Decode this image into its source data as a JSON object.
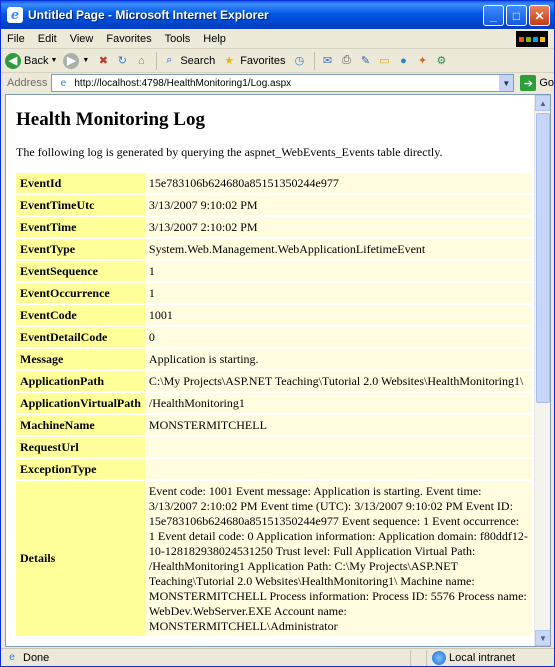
{
  "window": {
    "title": "Untitled Page - Microsoft Internet Explorer",
    "controls": {
      "minimize": "_",
      "maximize": "□",
      "close": "✕"
    }
  },
  "menu": [
    "File",
    "Edit",
    "View",
    "Favorites",
    "Tools",
    "Help"
  ],
  "toolbar": {
    "back_label": "Back",
    "search_label": "Search",
    "favorites_label": "Favorites"
  },
  "address": {
    "label": "Address",
    "url": "http://localhost:4798/HealthMonitoring1/Log.aspx",
    "go_label": "Go"
  },
  "page": {
    "heading": "Health Monitoring Log",
    "intro": "The following log is generated by querying the aspnet_WebEvents_Events table directly.",
    "rows": [
      {
        "key": "EventId",
        "value": "15e783106b624680a85151350244e977"
      },
      {
        "key": "EventTimeUtc",
        "value": "3/13/2007 9:10:02 PM"
      },
      {
        "key": "EventTime",
        "value": "3/13/2007 2:10:02 PM"
      },
      {
        "key": "EventType",
        "value": "System.Web.Management.WebApplicationLifetimeEvent"
      },
      {
        "key": "EventSequence",
        "value": "1"
      },
      {
        "key": "EventOccurrence",
        "value": "1"
      },
      {
        "key": "EventCode",
        "value": "1001"
      },
      {
        "key": "EventDetailCode",
        "value": "0"
      },
      {
        "key": "Message",
        "value": "Application is starting."
      },
      {
        "key": "ApplicationPath",
        "value": "C:\\My Projects\\ASP.NET Teaching\\Tutorial 2.0 Websites\\HealthMonitoring1\\"
      },
      {
        "key": "ApplicationVirtualPath",
        "value": "/HealthMonitoring1"
      },
      {
        "key": "MachineName",
        "value": "MONSTERMITCHELL"
      },
      {
        "key": "RequestUrl",
        "value": ""
      },
      {
        "key": "ExceptionType",
        "value": ""
      },
      {
        "key": "Details",
        "value": "Event code: 1001 Event message: Application is starting. Event time: 3/13/2007 2:10:02 PM Event time (UTC): 3/13/2007 9:10:02 PM Event ID: 15e783106b624680a85151350244e977 Event sequence: 1 Event occurrence: 1 Event detail code: 0 Application information: Application domain: f80ddf12-10-128182938024531250 Trust level: Full Application Virtual Path: /HealthMonitoring1 Application Path: C:\\My Projects\\ASP.NET Teaching\\Tutorial 2.0 Websites\\HealthMonitoring1\\ Machine name: MONSTERMITCHELL Process information: Process ID: 5576 Process name: WebDev.WebServer.EXE Account name: MONSTERMITCHELL\\Administrator"
      }
    ]
  },
  "status": {
    "left": "Done",
    "zone": "Local intranet"
  },
  "colors": {
    "key_cell": "#FFFF99",
    "value_cell": "#FFFCE0",
    "titlebar": "#0058E6"
  }
}
